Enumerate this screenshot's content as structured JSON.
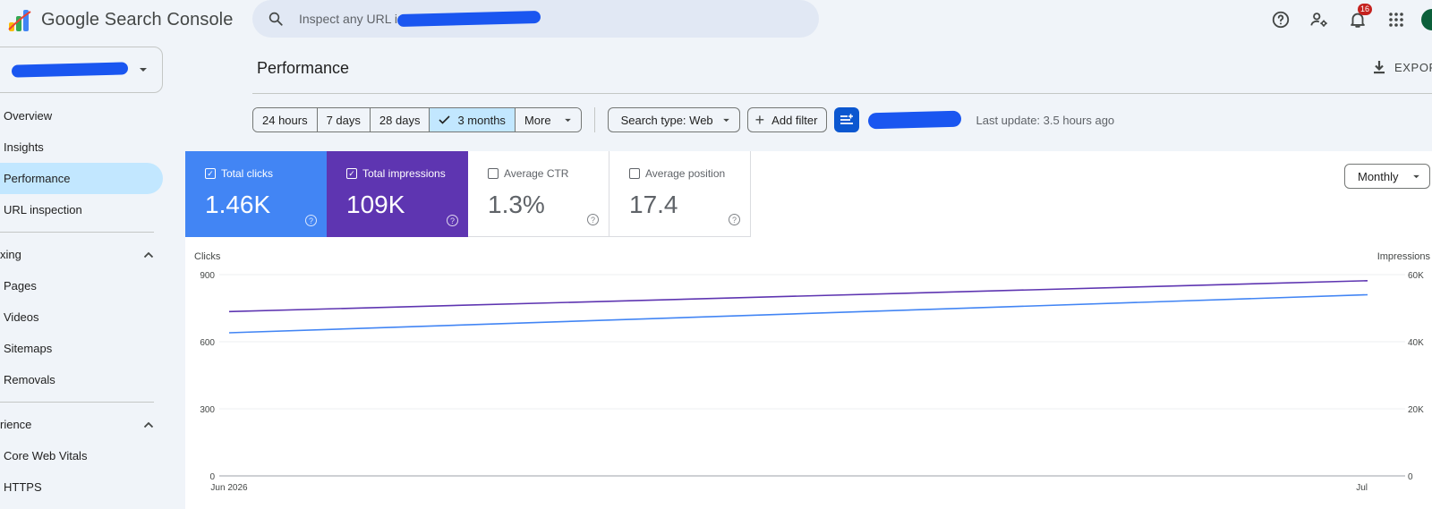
{
  "app": {
    "logo_text": "Google Search Console"
  },
  "search": {
    "placeholder": "Inspect any URL in"
  },
  "topbar": {
    "notification_count": "16"
  },
  "sidebar": {
    "items_top": [
      "Overview",
      "Insights",
      "Performance",
      "URL inspection"
    ],
    "section_indexing": "xing",
    "items_indexing": [
      "Pages",
      "Videos",
      "Sitemaps",
      "Removals"
    ],
    "section_experience": "rience",
    "items_experience": [
      "Core Web Vitals",
      "HTTPS"
    ]
  },
  "main": {
    "title": "Performance",
    "export_label": "EXPOR"
  },
  "filters": {
    "date_options": [
      "24 hours",
      "7 days",
      "28 days",
      "3 months",
      "More"
    ],
    "selected": "3 months",
    "search_type": "Search type: Web",
    "add_filter": "Add filter",
    "last_update": "Last update: 3.5 hours ago"
  },
  "metrics": [
    {
      "label": "Total clicks",
      "value": "1.46K",
      "checked": true,
      "color": "#4285f4"
    },
    {
      "label": "Total impressions",
      "value": "109K",
      "checked": true,
      "color": "#5e35b1"
    },
    {
      "label": "Average CTR",
      "value": "1.3%",
      "checked": false
    },
    {
      "label": "Average position",
      "value": "17.4",
      "checked": false
    }
  ],
  "granularity": "Monthly",
  "chart_data": {
    "type": "line",
    "x": [
      "Jun 2026",
      "Jul"
    ],
    "left_axis": {
      "label": "Clicks",
      "ticks": [
        "0",
        "300",
        "600",
        "900"
      ],
      "range": [
        0,
        900
      ]
    },
    "right_axis": {
      "label": "Impressions",
      "ticks": [
        "0",
        "20K",
        "40K",
        "60K"
      ],
      "range": [
        0,
        60000
      ]
    },
    "series": [
      {
        "name": "Clicks",
        "axis": "left",
        "color": "#4285f4",
        "values": [
          640,
          810
        ]
      },
      {
        "name": "Impressions",
        "axis": "right",
        "color": "#5e35b1",
        "values": [
          49000,
          58200
        ]
      }
    ],
    "grid": true
  }
}
